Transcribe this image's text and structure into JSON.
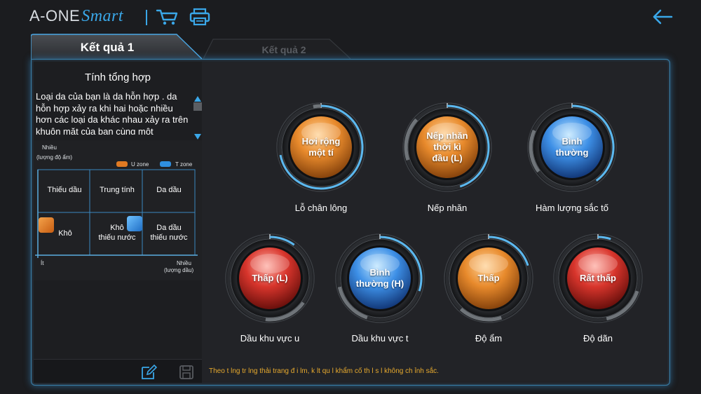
{
  "header": {
    "logo_main": "A-ONE",
    "logo_smart": "Smart",
    "cart_icon": "cart-icon",
    "print_icon": "printer-icon",
    "back_icon": "back-arrow-icon"
  },
  "tabs": [
    {
      "label": "Kết quả 1",
      "active": true
    },
    {
      "label": "Kết quả 2",
      "active": false
    }
  ],
  "left_panel": {
    "title": "Tính tổng hợp",
    "description": "Loại da của bạn là da hỗn hợp . da hỗn hợp xảy ra khi hai hoặc nhiều hơn các loại da khác nhau xảy ra trên khuôn mặt của bạn cùng một",
    "chart": {
      "y_label_1": "Nhiều",
      "y_label_2": "(lượng độ ẩm)",
      "legend_u": "U zone",
      "legend_t": "T zone",
      "cells": {
        "top_left": "Thiếu dầu",
        "top_mid": "Trung tính",
        "top_right": "Da dầu",
        "bottom_left": "Khô",
        "bottom_mid_1": "Khô",
        "bottom_mid_2": "thiếu nước",
        "bottom_right_1": "Da dầu",
        "bottom_right_2": "thiếu nước"
      },
      "x_min": "Ít",
      "x_max_1": "Nhiều",
      "x_max_2": "(lượng dầu)",
      "u_zone_color": "#e07a22",
      "t_zone_color": "#2f8fe0"
    },
    "footer_icons": [
      "edit-icon",
      "save-icon"
    ]
  },
  "gauges": [
    {
      "value_text_1": "Hơi rộng",
      "value_text_2": "một tí",
      "value_text_3": "",
      "label": "Lỗ chân lông",
      "color": "orange",
      "level": 0.72
    },
    {
      "value_text_1": "Nếp nhăn",
      "value_text_2": "thời kì",
      "value_text_3": "đầu (L)",
      "label": "Nếp nhăn",
      "color": "orange",
      "level": 0.45
    },
    {
      "value_text_1": "Bình",
      "value_text_2": "thường",
      "value_text_3": "",
      "label": "Hàm lượng sắc tố",
      "color": "blue",
      "level": 0.4
    },
    {
      "value_text_1": "Thấp (L)",
      "value_text_2": "",
      "value_text_3": "",
      "label": "Dầu khu vực u",
      "color": "red",
      "level": 0.1
    },
    {
      "value_text_1": "Bình",
      "value_text_2": "thường (H)",
      "value_text_3": "",
      "label": "Dầu khu vực t",
      "color": "blue",
      "level": 0.3
    },
    {
      "value_text_1": "Thấp",
      "value_text_2": "",
      "value_text_3": "",
      "label": "Độ ẩm",
      "color": "orange",
      "level": 0.2
    },
    {
      "value_text_1": "Rất thấp",
      "value_text_2": "",
      "value_text_3": "",
      "label": "Độ dãn",
      "color": "red",
      "level": 0.05
    }
  ],
  "notice": "Theo t lng tr lng thải trang  đ i lm, k lt qu l khẩm cố th l s l không ch ỉnh sắc."
}
